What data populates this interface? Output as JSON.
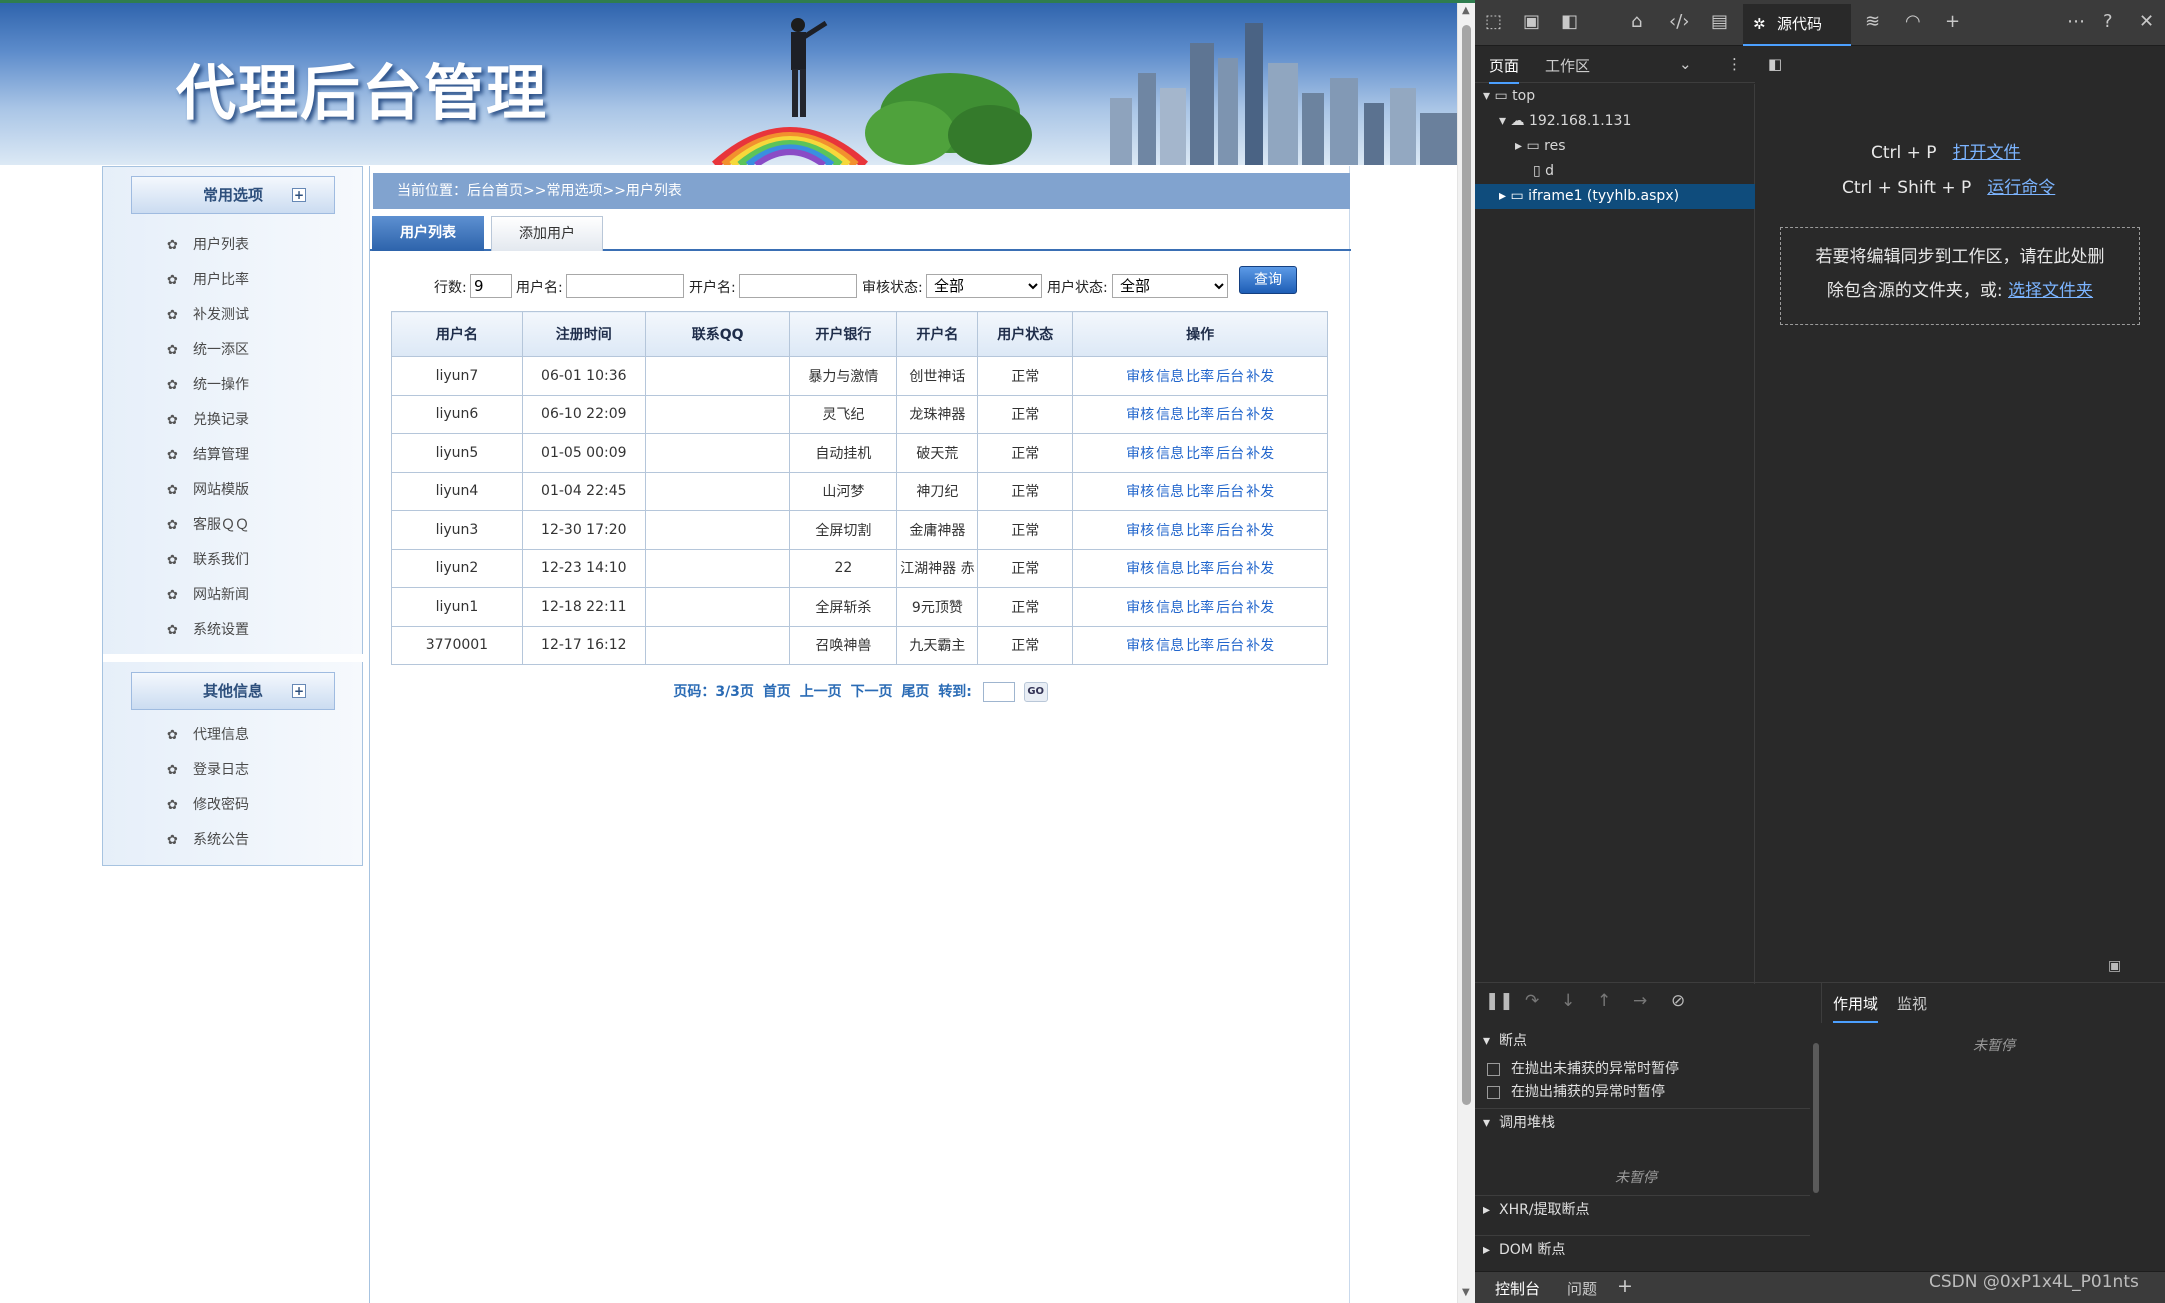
{
  "banner": {
    "title": "代理后台管理"
  },
  "sidebar": {
    "group1": {
      "title": "常用选项",
      "items": [
        "用户列表",
        "用户比率",
        "补发测试",
        "统一添区",
        "统一操作",
        "兑换记录",
        "结算管理",
        "网站模版",
        "客服ＱＱ",
        "联系我们",
        "网站新闻",
        "系统设置"
      ]
    },
    "group2": {
      "title": "其他信息",
      "items": [
        "代理信息",
        "登录日志",
        "修改密码",
        "系统公告"
      ]
    }
  },
  "breadcrumb": "当前位置：后台首页>>常用选项>>用户列表",
  "tabs": {
    "list": "用户列表",
    "add": "添加用户"
  },
  "filter": {
    "rows_label": "行数:",
    "rows_value": "9",
    "username_label": "用户名:",
    "username_value": "",
    "opener_label": "开户名:",
    "opener_value": "",
    "audit_label": "审核状态:",
    "audit_value": "全部",
    "status_label": "用户状态:",
    "status_value": "全部",
    "query_button": "查询"
  },
  "table": {
    "headers": [
      "用户名",
      "注册时间",
      "联系QQ",
      "开户银行",
      "开户名",
      "用户状态",
      "操作"
    ],
    "actions": [
      "审核",
      "信息",
      "比率",
      "后台",
      "补发"
    ],
    "rows": [
      [
        "liyun7",
        "06-01 10:36",
        "",
        "暴力与激情",
        "创世神话",
        "正常"
      ],
      [
        "liyun6",
        "06-10 22:09",
        "",
        "灵飞纪",
        "龙珠神器",
        "正常"
      ],
      [
        "liyun5",
        "01-05 00:09",
        "",
        "自动挂机",
        "破天荒",
        "正常"
      ],
      [
        "liyun4",
        "01-04 22:45",
        "",
        "山河梦",
        "神刀纪",
        "正常"
      ],
      [
        "liyun3",
        "12-30 17:20",
        "",
        "全屏切割",
        "金庸神器",
        "正常"
      ],
      [
        "liyun2",
        "12-23 14:10",
        "",
        "22",
        "江湖神器 赤",
        "正常"
      ],
      [
        "liyun1",
        "12-18 22:11",
        "",
        "全屏斩杀",
        "9元顶赞",
        "正常"
      ],
      [
        "3770001",
        "12-17 16:12",
        "",
        "召唤神兽",
        "九天霸主",
        "正常"
      ]
    ]
  },
  "pager": {
    "info": "页码：3/3页",
    "first": "首页",
    "prev": "上一页",
    "next": "下一页",
    "last": "尾页",
    "goto_label": "转到:",
    "go": "GO"
  },
  "devtools": {
    "sources_tab": "源代码",
    "sub_tabs": [
      "页面",
      "工作区"
    ],
    "tree": [
      "top",
      "192.168.1.131",
      "res",
      "d",
      "iframe1 (tyyhlb.aspx)"
    ],
    "shortcut1_keys": "Ctrl + P",
    "shortcut1_action": "打开文件",
    "shortcut2_keys": "Ctrl + Shift + P",
    "shortcut2_action": "运行命令",
    "drop_text_1": "若要将编辑同步到工作区，请在此处删",
    "drop_text_2": "除包含源的文件夹，或:",
    "drop_link": "选择文件夹",
    "scope_tabs": [
      "作用域",
      "监视"
    ],
    "not_paused": "未暂停",
    "breakpoints": "断点",
    "chk_uncaught": "在抛出未捕获的异常时暂停",
    "chk_caught": "在抛出捕获的异常时暂停",
    "callstack": "调用堆栈",
    "xhr": "XHR/提取断点",
    "dom": "DOM 断点",
    "console_tabs": [
      "控制台",
      "问题"
    ]
  },
  "watermark": "CSDN @0xP1x4L_P01nts",
  "colors": {
    "accent": "#3a6fb4",
    "link": "#2266cc",
    "devtools_bg": "#292929"
  }
}
